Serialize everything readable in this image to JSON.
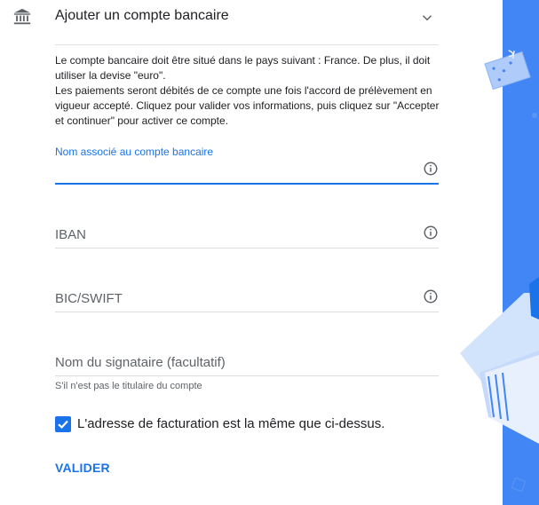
{
  "header": {
    "title": "Ajouter un compte bancaire",
    "icon": "bank-icon",
    "toggle_icon": "chevron-down-icon"
  },
  "description": {
    "line1": "Le compte bancaire doit être situé dans le pays suivant : France. De plus, il doit utiliser la devise \"euro\".",
    "line2": "Les paiements seront débités de ce compte une fois l'accord de prélèvement en vigueur accepté. Cliquez pour valider vos informations, puis cliquez sur \"Accepter et continuer\" pour activer ce compte."
  },
  "form": {
    "account_name": {
      "label": "Nom associé au compte bancaire",
      "value": ""
    },
    "iban": {
      "placeholder": "IBAN"
    },
    "bic": {
      "placeholder": "BIC/SWIFT"
    },
    "signatory": {
      "placeholder": "Nom du signataire (facultatif)",
      "hint": "S'il n'est pas le titulaire du compte"
    },
    "same_billing": {
      "label": "L'adresse de facturation est la même que ci-dessus.",
      "checked": true
    },
    "submit_label": "VALIDER"
  },
  "colors": {
    "accent": "#1a73e8",
    "brand_blue": "#4285f4"
  }
}
